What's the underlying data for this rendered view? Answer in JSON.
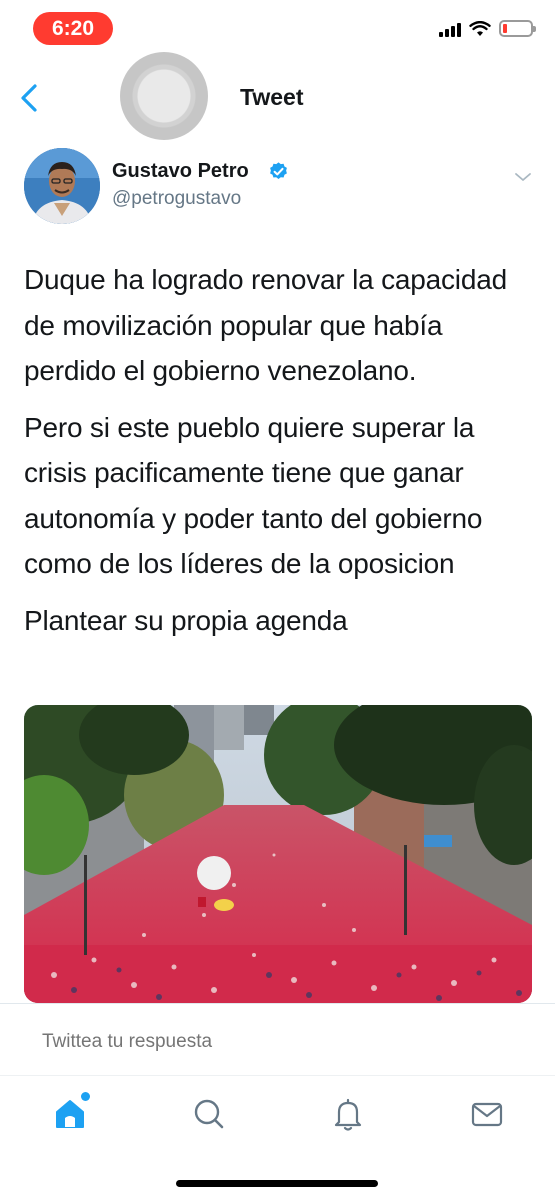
{
  "status_bar": {
    "time": "6:20"
  },
  "nav": {
    "title": "Tweet",
    "back_icon": "chevron-left-icon"
  },
  "author": {
    "name": "Gustavo Petro",
    "handle": "@petrogustavo",
    "verified": true
  },
  "tweet": {
    "paragraphs": [
      "Duque ha logrado renovar la capacidad de movilización popular que había perdido el gobierno venezolano.",
      "Pero si este pueblo quiere superar la crisis pacificamente tiene que ganar autonomía y poder tanto del gobierno como de los líderes de la oposicion",
      "Plantear su propia agenda"
    ]
  },
  "reply": {
    "placeholder": "Twittea tu respuesta"
  },
  "tabs": [
    {
      "name": "home",
      "icon": "home-icon"
    },
    {
      "name": "search",
      "icon": "search-icon"
    },
    {
      "name": "notifications",
      "icon": "bell-icon"
    },
    {
      "name": "messages",
      "icon": "mail-icon"
    }
  ],
  "colors": {
    "accent": "#1da1f2",
    "text": "#14171a",
    "secondary": "#657786",
    "recording": "#ff3b30"
  }
}
